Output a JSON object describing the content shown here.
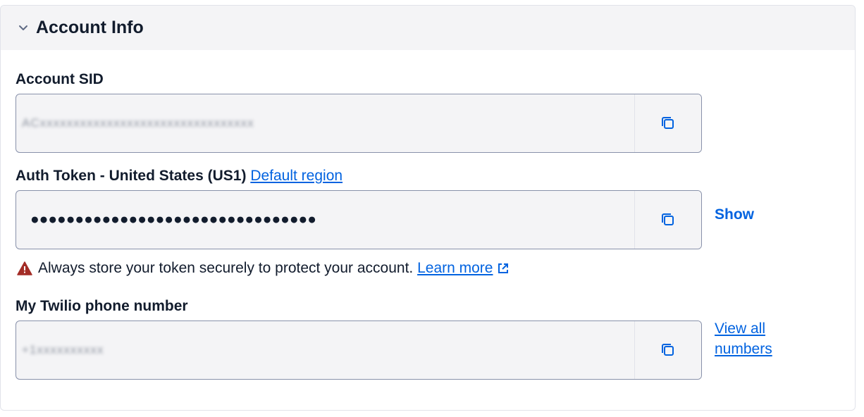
{
  "panel": {
    "title": "Account Info",
    "collapse_icon": "chevron-down-icon"
  },
  "account_sid": {
    "label": "Account SID",
    "value": "ACxxxxxxxxxxxxxxxxxxxxxxxxxxxxxxxx",
    "copy_icon": "copy-icon"
  },
  "auth_token": {
    "label": "Auth Token - United States (US1)",
    "region_link": "Default region",
    "value": "●●●●●●●●●●●●●●●●●●●●●●●●●●●●●●●●",
    "copy_icon": "copy-icon",
    "show_label": "Show"
  },
  "warning": {
    "icon": "warning-icon",
    "text": "Always store your token securely to protect your account.",
    "link": "Learn more",
    "link_icon": "external-link-icon"
  },
  "phone": {
    "label": "My Twilio phone number",
    "value": "+1xxxxxxxxxx",
    "copy_icon": "copy-icon",
    "view_all_label": "View all numbers"
  },
  "colors": {
    "link": "#0263e0",
    "warning": "#a32c26",
    "field_bg": "#f4f4f6",
    "field_border": "#8891aa"
  }
}
